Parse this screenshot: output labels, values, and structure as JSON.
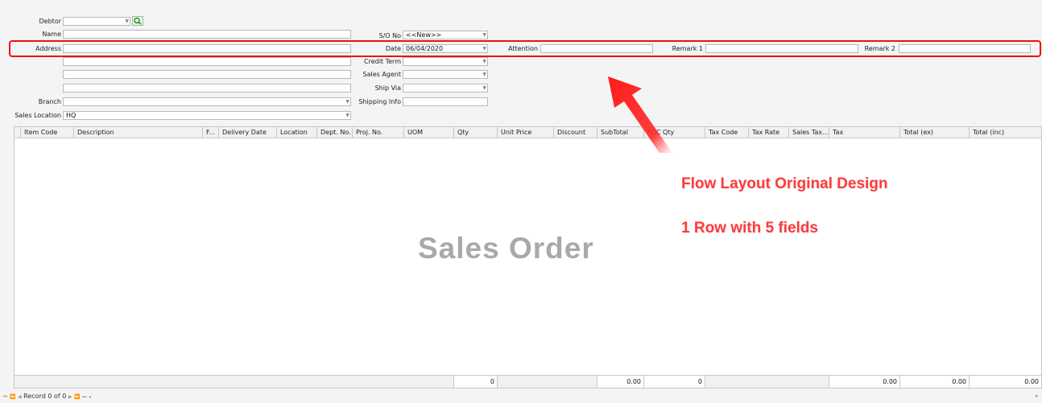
{
  "header": {
    "debtor_label": "Debtor",
    "name_label": "Name",
    "address_label": "Address",
    "branch_label": "Branch",
    "sales_location_label": "Sales Location",
    "sales_location_value": "HQ",
    "so_no_label": "S/O No",
    "so_no_value": "<<New>>",
    "date_label": "Date",
    "date_value": "06/04/2020",
    "credit_term_label": "Credit Term",
    "sales_agent_label": "Sales Agent",
    "ship_via_label": "Ship Via",
    "shipping_info_label": "Shipping Info",
    "attention_label": "Attention",
    "remark1_label": "Remark 1",
    "remark2_label": "Remark 2"
  },
  "grid": {
    "columns": [
      "Item Code",
      "Description",
      "F...",
      "Delivery Date",
      "Location",
      "Dept. No.",
      "Proj. No.",
      "UOM",
      "Qty",
      "Unit Price",
      "Discount",
      "SubTotal",
      "FOC Qty",
      "Tax Code",
      "Tax Rate",
      "Sales Tax...",
      "Tax",
      "Total (ex)",
      "Total (inc)"
    ],
    "footer": {
      "qty_total": "0",
      "subtotal": "0.00",
      "foc_qty": "0",
      "tax": "0.00",
      "total_ex": "0.00",
      "total_inc": "0.00"
    }
  },
  "watermark": "Sales Order",
  "annotation": {
    "line1": "Flow Layout Original Design",
    "line2": "1 Row with 5 fields",
    "color": "#ff3a3a"
  },
  "navigator": {
    "record_text": "Record 0 of 0"
  },
  "icons": {
    "lookup": "search-icon",
    "dropdown": "chevron-down-icon"
  }
}
